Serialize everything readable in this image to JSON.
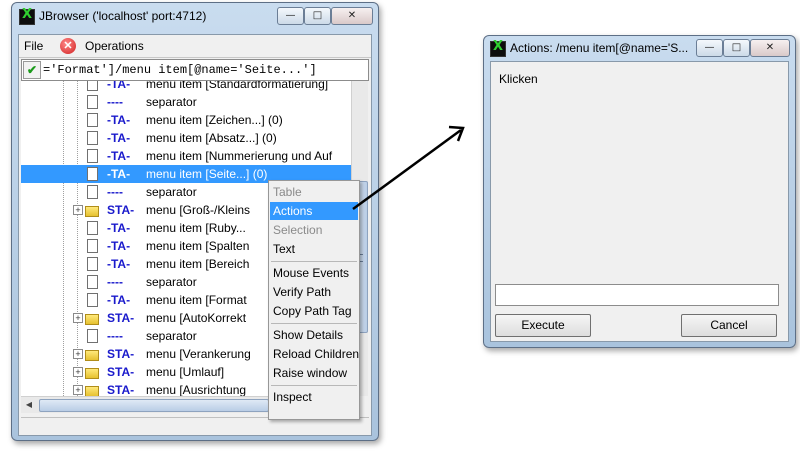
{
  "jbrowser": {
    "title": "JBrowser ('localhost' port:4712)",
    "window_buttons": {
      "minimize": "—",
      "maximize": "□",
      "close": "✕"
    },
    "menu": {
      "file": "File",
      "operations": "Operations"
    },
    "path_check": "✔",
    "path_text": "='Format']/menu item[@name='Seite...']",
    "tree_rows": [
      {
        "icon": "doc-icon",
        "kind": "-TA-",
        "label": "menu item [Standardformatierung]"
      },
      {
        "icon": "doc-icon",
        "kind": "----",
        "label": "separator"
      },
      {
        "icon": "doc-icon",
        "kind": "-TA-",
        "label": "menu item [Zeichen...]  (0)"
      },
      {
        "icon": "doc-icon",
        "kind": "-TA-",
        "label": "menu item [Absatz...]  (0)"
      },
      {
        "icon": "doc-icon",
        "kind": "-TA-",
        "label": "menu item [Nummerierung und Auf"
      },
      {
        "icon": "doc-icon",
        "kind": "-TA-",
        "label": "menu item [Seite...]  (0)",
        "selected": true
      },
      {
        "icon": "doc-icon",
        "kind": "----",
        "label": "separator"
      },
      {
        "icon": "folder-icon",
        "expander": "+",
        "kind": "STA-",
        "label": "menu [Groß-/Kleins"
      },
      {
        "icon": "doc-icon",
        "kind": "-TA-",
        "label": "menu item [Ruby..."
      },
      {
        "icon": "doc-icon",
        "kind": "-TA-",
        "label": "menu item [Spalten"
      },
      {
        "icon": "doc-icon",
        "kind": "-TA-",
        "label": "menu item [Bereich"
      },
      {
        "icon": "doc-icon",
        "kind": "----",
        "label": "separator"
      },
      {
        "icon": "doc-icon",
        "kind": "-TA-",
        "label": "menu item [Format"
      },
      {
        "icon": "folder-icon",
        "expander": "+",
        "kind": "STA-",
        "label": "menu [AutoKorrekt"
      },
      {
        "icon": "doc-icon",
        "kind": "----",
        "label": "separator"
      },
      {
        "icon": "folder-icon",
        "expander": "+",
        "kind": "STA-",
        "label": "menu [Verankerung"
      },
      {
        "icon": "folder-icon",
        "expander": "+",
        "kind": "STA-",
        "label": "menu [Umlauf]"
      },
      {
        "icon": "folder-icon",
        "expander": "+",
        "kind": "STA-",
        "label": "menu [Ausrichtung"
      }
    ],
    "context_menu": [
      {
        "label": "Table",
        "disabled": true
      },
      {
        "label": "Actions",
        "highlighted": true
      },
      {
        "label": "Selection",
        "disabled": true
      },
      {
        "label": "Text"
      },
      {
        "label": "Mouse Events",
        "separator_before": true
      },
      {
        "label": "Verify Path"
      },
      {
        "label": "Copy Path Tag"
      },
      {
        "label": "Show Details",
        "separator_before": true
      },
      {
        "label": "Reload Children"
      },
      {
        "label": "Raise window"
      },
      {
        "label": "Inspect",
        "separator_before": true
      }
    ]
  },
  "actions_window": {
    "title": "Actions: /menu item[@name='S...",
    "window_buttons": {
      "minimize": "—",
      "maximize": "□",
      "close": "✕"
    },
    "output": "Klicken",
    "command_value": "",
    "execute_label": "Execute",
    "cancel_label": "Cancel"
  },
  "colors": {
    "selection": "#3399ff",
    "kind_text": "#1a1acc",
    "title_bar": "#b9cfe6"
  }
}
